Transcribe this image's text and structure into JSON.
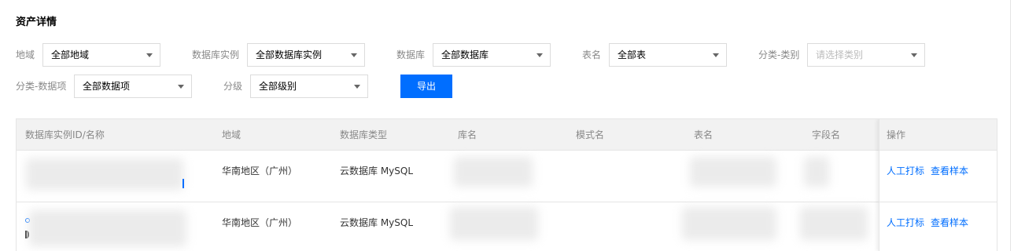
{
  "title": "资产详情",
  "filters": {
    "region": {
      "label": "地域",
      "value": "全部地域"
    },
    "instance": {
      "label": "数据库实例",
      "value": "全部数据库实例"
    },
    "database": {
      "label": "数据库",
      "value": "全部数据库"
    },
    "table": {
      "label": "表名",
      "value": "全部表"
    },
    "category": {
      "label": "分类-类别",
      "placeholder": "请选择类别"
    },
    "data_item": {
      "label": "分类-数据项",
      "value": "全部数据项"
    },
    "level": {
      "label": "分级",
      "value": "全部级别"
    }
  },
  "export_label": "导出",
  "table": {
    "headers": [
      "数据库实例ID/名称",
      "地域",
      "数据库类型",
      "库名",
      "模式名",
      "表名",
      "字段名",
      "操作"
    ],
    "rows": [
      {
        "region": "华南地区（广州）",
        "db_type": "云数据库 MySQL",
        "action_tag": "人工打标",
        "action_sample": "查看样本"
      },
      {
        "region": "华南地区（广州）",
        "db_type": "云数据库 MySQL",
        "action_tag": "人工打标",
        "action_sample": "查看样本"
      }
    ]
  }
}
